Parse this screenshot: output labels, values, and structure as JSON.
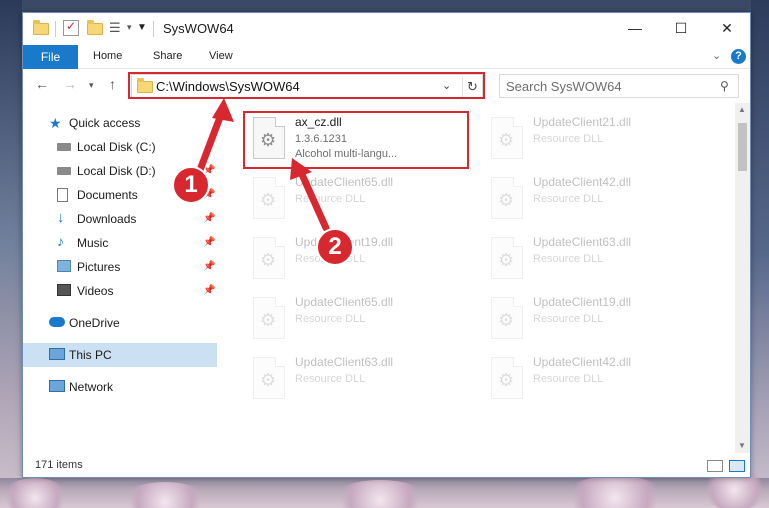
{
  "window": {
    "title": "SysWOW64",
    "controls": {
      "minimize": "—",
      "maximize": "☐",
      "close": "✕"
    }
  },
  "ribbon": {
    "file_tab": "File",
    "tabs": [
      "Home",
      "Share",
      "View"
    ]
  },
  "address_bar": {
    "path": "C:\\Windows\\SysWOW64",
    "search_placeholder": "Search SysWOW64"
  },
  "sidebar": {
    "items": [
      {
        "label": "Quick access",
        "icon": "star-icon",
        "pinned": false
      },
      {
        "label": "Local Disk (C:)",
        "icon": "drive-icon",
        "pinned": true
      },
      {
        "label": "Local Disk (D:)",
        "icon": "drive-icon",
        "pinned": true
      },
      {
        "label": "Documents",
        "icon": "documents-icon",
        "pinned": true
      },
      {
        "label": "Downloads",
        "icon": "download-icon",
        "pinned": true
      },
      {
        "label": "Music",
        "icon": "music-icon",
        "pinned": true
      },
      {
        "label": "Pictures",
        "icon": "pictures-icon",
        "pinned": true
      },
      {
        "label": "Videos",
        "icon": "video-icon",
        "pinned": true
      },
      {
        "label": "OneDrive",
        "icon": "cloud-icon",
        "pinned": false
      },
      {
        "label": "This PC",
        "icon": "computer-icon",
        "pinned": false,
        "selected": true
      },
      {
        "label": "Network",
        "icon": "network-icon",
        "pinned": false
      }
    ]
  },
  "files": [
    {
      "name": "ax_cz.dll",
      "version": "1.3.6.1231",
      "description": "Alcohol multi-langu..."
    },
    {
      "name": "UpdateClient21.dll",
      "description": "Resource DLL"
    },
    {
      "name": "UpdateClient65.dll",
      "description": "Resource DLL"
    },
    {
      "name": "UpdateClient42.dll",
      "description": "Resource DLL"
    },
    {
      "name": "UpdateClient19.dll",
      "description": "Resource DLL"
    },
    {
      "name": "UpdateClient63.dll",
      "description": "Resource DLL"
    },
    {
      "name": "UpdateClient65.dll",
      "description": "Resource DLL"
    },
    {
      "name": "UpdateClient19.dll",
      "description": "Resource DLL"
    },
    {
      "name": "UpdateClient63.dll",
      "description": "Resource DLL"
    },
    {
      "name": "UpdateClient42.dll",
      "description": "Resource DLL"
    }
  ],
  "status": {
    "item_count": "171 items"
  },
  "callouts": {
    "first": "1",
    "second": "2"
  },
  "colors": {
    "accent": "#1979ca",
    "highlight": "#d7282f",
    "selected": "#cce0f4"
  }
}
